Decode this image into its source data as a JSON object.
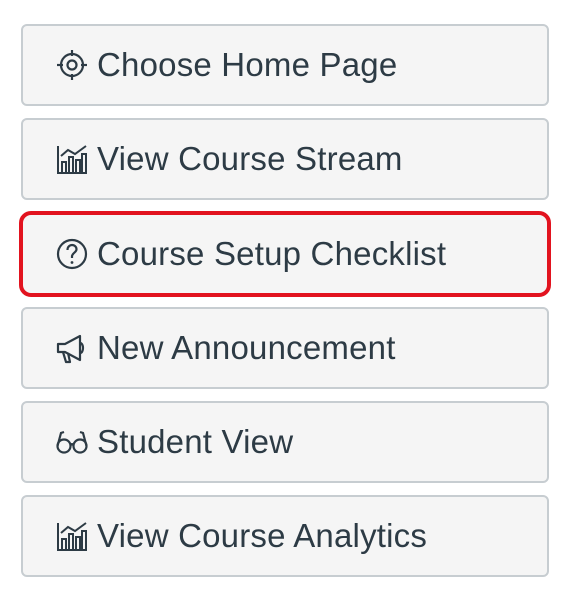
{
  "buttons": [
    {
      "label": "Choose Home Page",
      "icon": "target-icon"
    },
    {
      "label": "View Course Stream",
      "icon": "analytics-icon"
    },
    {
      "label": "Course Setup Checklist",
      "icon": "question-circle-icon",
      "highlighted": true
    },
    {
      "label": "New Announcement",
      "icon": "megaphone-icon"
    },
    {
      "label": "Student View",
      "icon": "glasses-icon"
    },
    {
      "label": "View Course Analytics",
      "icon": "analytics-icon"
    }
  ],
  "colors": {
    "button_bg": "#f5f5f5",
    "button_border": "#c7cdd1",
    "text": "#2d3b45",
    "highlight": "#e2131f"
  }
}
